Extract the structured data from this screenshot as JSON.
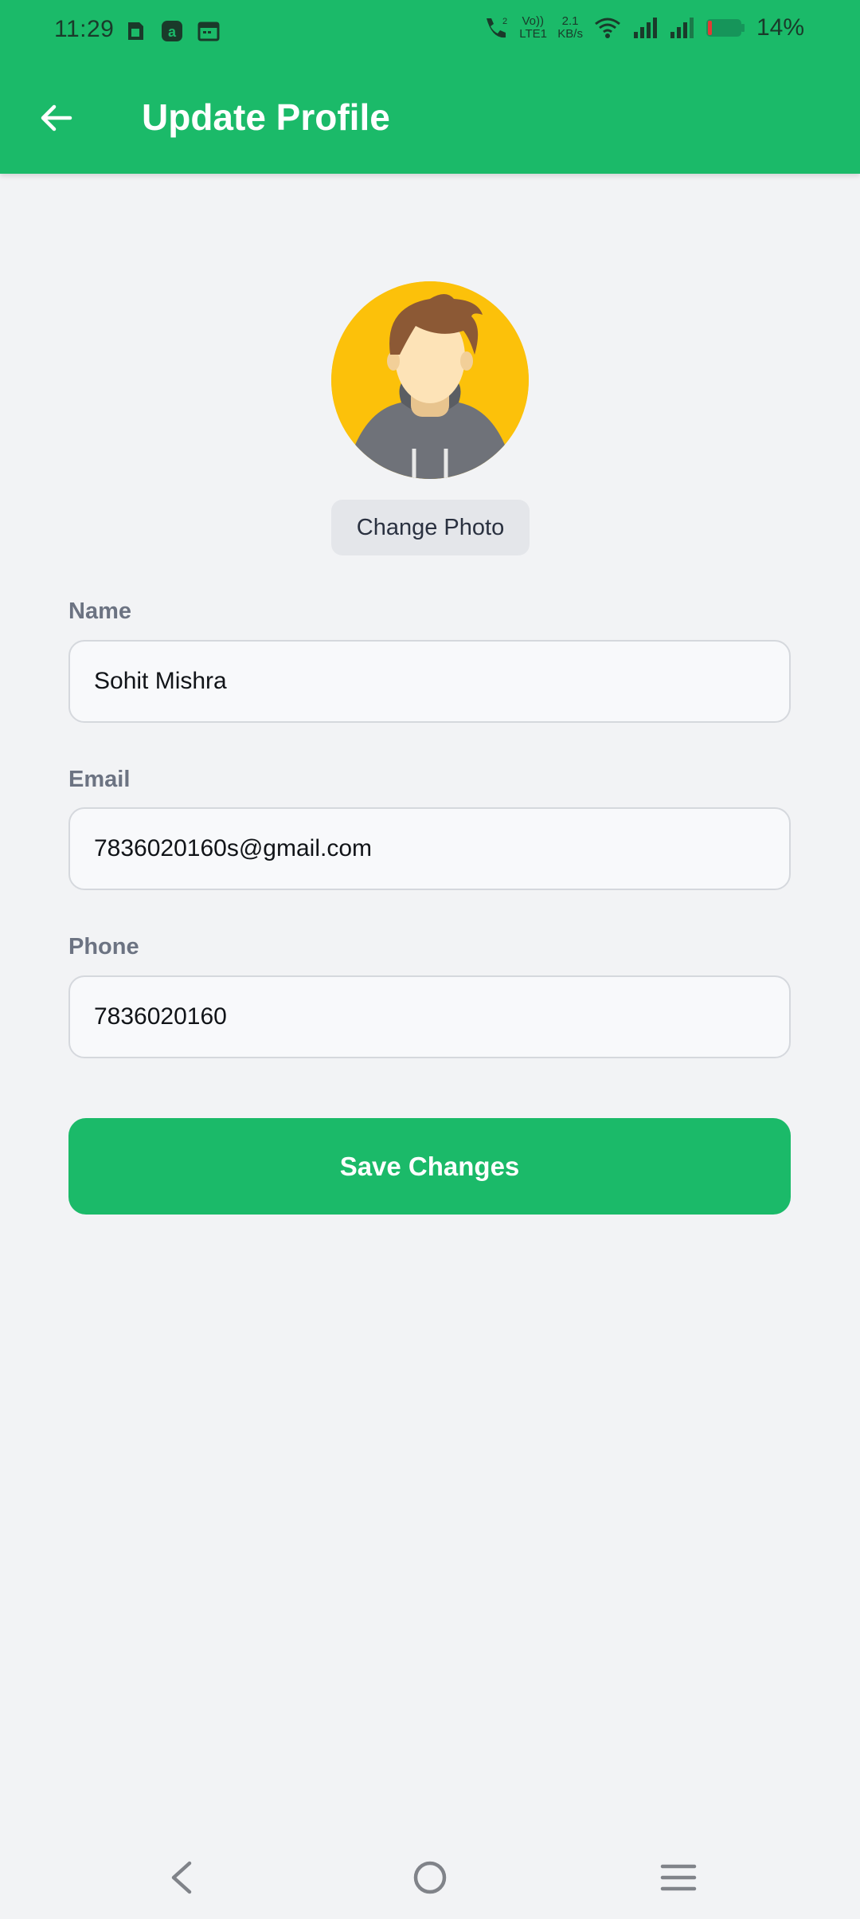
{
  "status_bar": {
    "time": "11:29",
    "battery_percent": "14%",
    "volte_label": "Vo)) LTE1",
    "net_speed_value": "2.1",
    "net_speed_unit": "KB/s",
    "sim_label": "2",
    "icons": [
      "sim-card-icon",
      "a-app-icon",
      "calendar-icon",
      "call-icon",
      "wifi-icon",
      "signal-icon",
      "signal-icon",
      "battery-icon"
    ]
  },
  "header": {
    "title": "Update Profile",
    "back_icon": "arrow-left-icon"
  },
  "profile": {
    "change_photo_label": "Change Photo"
  },
  "form": {
    "name_label": "Name",
    "name_value": "Sohit Mishra",
    "email_label": "Email",
    "email_value": "7836020160s@gmail.com",
    "phone_label": "Phone",
    "phone_value": "7836020160",
    "save_label": "Save Changes"
  },
  "nav_bar": {
    "icons": [
      "back-icon",
      "home-icon",
      "menu-icon"
    ]
  },
  "colors": {
    "brand": "#1bba69",
    "background": "#f2f3f5",
    "avatar_bg": "#fcc10a"
  }
}
